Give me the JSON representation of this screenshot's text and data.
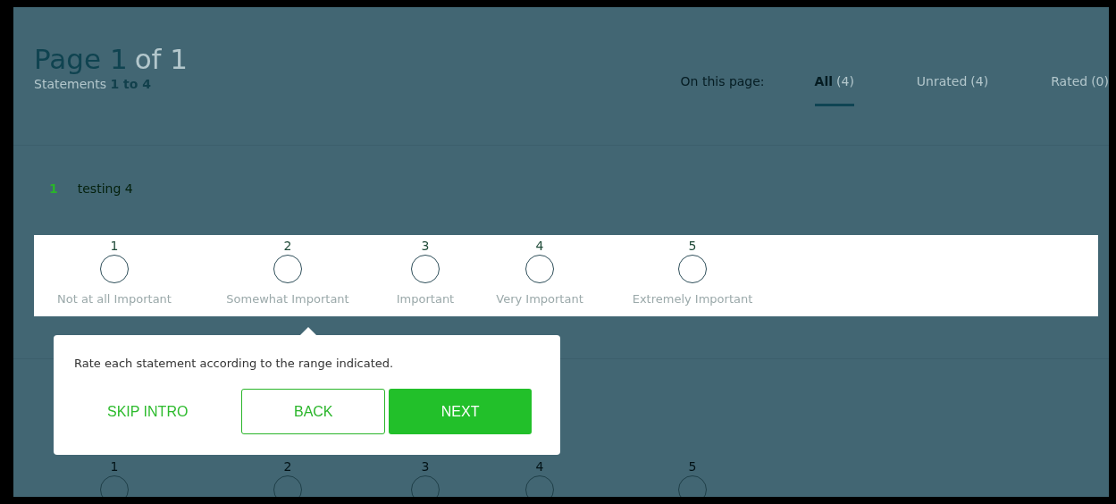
{
  "header": {
    "title": "Page 1",
    "title_suffix": "of 1",
    "subtitle": "Statements **1 to 4**",
    "filter_label": "On this page:",
    "tabs": [
      {
        "label": "All",
        "count": "(4)",
        "selected": true
      },
      {
        "label": "Unrated",
        "count": "(4)",
        "selected": false
      },
      {
        "label": "Rated",
        "count": "(0)",
        "selected": false
      }
    ]
  },
  "statements": [
    {
      "number": "1",
      "text": "testing 4",
      "highlighted": true,
      "options": [
        {
          "value": "1",
          "label": "Not at all Important",
          "selected": false
        },
        {
          "value": "2",
          "label": "Somewhat Important",
          "selected": false
        },
        {
          "value": "3",
          "label": "Important",
          "selected": false
        },
        {
          "value": "4",
          "label": "Very Important",
          "selected": false
        },
        {
          "value": "5",
          "label": "Extremely Important",
          "selected": false
        }
      ]
    },
    {
      "highlighted": false,
      "options": [
        {
          "value": "1",
          "selected": false
        },
        {
          "value": "2",
          "selected": false
        },
        {
          "value": "3",
          "selected": false
        },
        {
          "value": "4",
          "selected": false
        },
        {
          "value": "5",
          "selected": false
        }
      ]
    }
  ],
  "intro_popup": {
    "message": "Rate each statement according to the range indicated.",
    "skip": "SKIP INTRO",
    "back": "BACK",
    "next": "NEXT"
  }
}
